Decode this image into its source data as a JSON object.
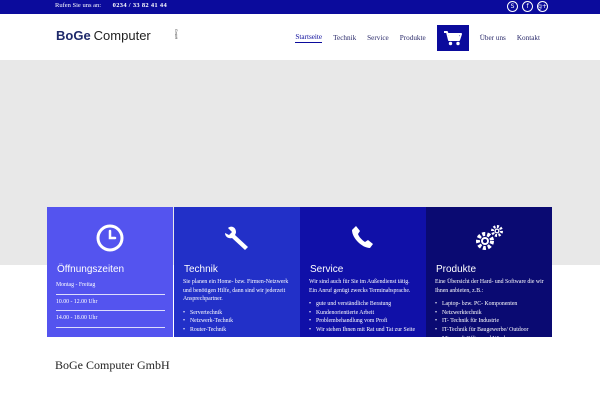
{
  "topbar": {
    "call_label": "Rufen Sie uns an:",
    "phone": "0234 / 33 82 41 44",
    "social_icons": [
      "skype-icon",
      "facebook-icon",
      "google-plus-icon"
    ]
  },
  "header": {
    "logo_part1": "BoGe",
    "logo_part2": "Computer",
    "logo_tag": "GmbH",
    "nav": [
      {
        "label": "Startseite",
        "active": true
      },
      {
        "label": "Technik"
      },
      {
        "label": "Service"
      },
      {
        "label": "Produkte"
      },
      {
        "label": "Über uns"
      },
      {
        "label": "Kontakt"
      }
    ],
    "cart_icon": "shopping-cart-icon"
  },
  "boxes": {
    "hours": {
      "icon": "clock-icon",
      "title": "Öffnungszeiten",
      "rows": [
        "Montag - Freitag",
        "10.00 - 12.00 Uhr",
        "14.00 - 18.00 Uhr"
      ]
    },
    "technik": {
      "icon": "wrench-icon",
      "title": "Technik",
      "text": "Sie planen ein Home- bzw. Firmen-Netzwerk und benötigen Hilfe, dann sind wir jederzeit Ansprechpartner.",
      "items": [
        "Servertechnik",
        "Netzwerk-Technik",
        "Router-Technik"
      ]
    },
    "service": {
      "icon": "phone-icon",
      "title": "Service",
      "text": "Wir sind auch für Sie im Außendienst tätig. Ein Anruf genügt zwecks Terminabsprache.",
      "items": [
        "gute und verständliche Beratung",
        "Kundenorientierte Arbeit",
        "Problembehandlung vom Profi",
        "Wir stehen Ihnen mit Rat und Tat zur Seite"
      ]
    },
    "produkte": {
      "icon": "gears-icon",
      "title": "Produkte",
      "text": "Eine Übersicht der Hard- und Software die wir Ihnen anbieten, z.B.:",
      "items": [
        "Laptop- bzw. PC- Komponenten",
        "Netzwerktechnik",
        "IT- Technik für Industrie",
        "IT-Technik für Baugewerbe/ Outdoor",
        "Microsoft Office und Windows"
      ]
    }
  },
  "company": "BoGe Computer GmbH",
  "colors": {
    "brand_blue": "#0b0b9c",
    "box1": "#5454ef",
    "box2": "#2230c8",
    "box3": "#1010a8",
    "box4": "#0a0a72"
  }
}
